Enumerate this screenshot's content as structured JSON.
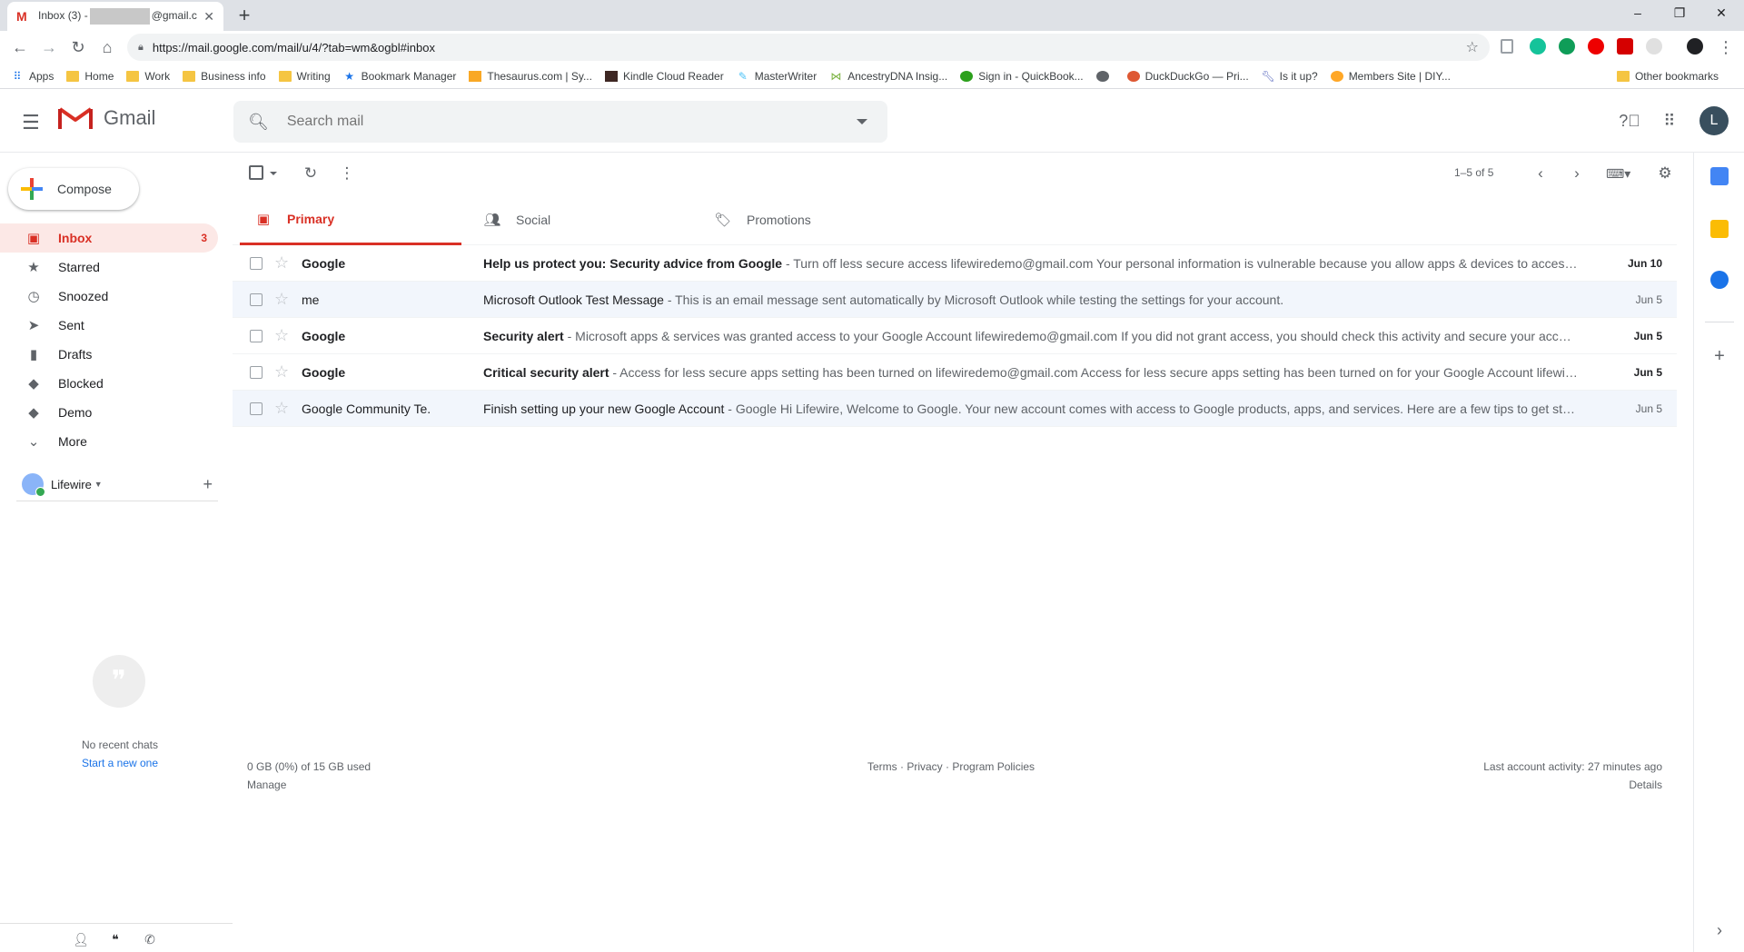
{
  "browser": {
    "tab_title_prefix": "Inbox (3) -",
    "tab_title_suffix": "@gmail.c",
    "url": "https://mail.google.com/mail/u/4/?tab=wm&ogbl#inbox",
    "bookmarks": [
      {
        "label": "Apps",
        "icon": "apps-grid-icon"
      },
      {
        "label": "Home",
        "icon": "folder-icon"
      },
      {
        "label": "Work",
        "icon": "folder-icon"
      },
      {
        "label": "Business info",
        "icon": "folder-icon"
      },
      {
        "label": "Writing",
        "icon": "folder-icon"
      },
      {
        "label": "Bookmark Manager",
        "icon": "star-icon"
      },
      {
        "label": "Thesaurus.com | Sy...",
        "icon": "thesaurus-icon"
      },
      {
        "label": "Kindle Cloud Reader",
        "icon": "kindle-icon"
      },
      {
        "label": "MasterWriter",
        "icon": "masterwriter-icon"
      },
      {
        "label": "AncestryDNA Insig...",
        "icon": "ancestry-icon"
      },
      {
        "label": "Sign in - QuickBook...",
        "icon": "quickbooks-icon"
      },
      {
        "label": "",
        "icon": "globe-icon"
      },
      {
        "label": "DuckDuckGo — Pri...",
        "icon": "duckduckgo-icon"
      },
      {
        "label": "Is it up?",
        "icon": "wrench-icon"
      },
      {
        "label": "Members Site | DIY...",
        "icon": "members-icon"
      }
    ],
    "other_bookmarks": "Other bookmarks"
  },
  "gmail": {
    "brand": "Gmail",
    "search_placeholder": "Search mail",
    "avatar_letter": "L",
    "compose_label": "Compose",
    "nav": [
      {
        "label": "Inbox",
        "count": "3",
        "icon": "inbox-icon",
        "active": true
      },
      {
        "label": "Starred",
        "count": "",
        "icon": "star-icon",
        "active": false
      },
      {
        "label": "Snoozed",
        "count": "",
        "icon": "clock-icon",
        "active": false
      },
      {
        "label": "Sent",
        "count": "",
        "icon": "send-icon",
        "active": false
      },
      {
        "label": "Drafts",
        "count": "",
        "icon": "draft-icon",
        "active": false
      },
      {
        "label": "Blocked",
        "count": "",
        "icon": "label-icon",
        "active": false
      },
      {
        "label": "Demo",
        "count": "",
        "icon": "label-icon",
        "active": false
      },
      {
        "label": "More",
        "count": "",
        "icon": "chevron-down-icon",
        "active": false
      }
    ],
    "account_name": "Lifewire",
    "chat": {
      "no_chats": "No recent chats",
      "start_new": "Start a new one"
    },
    "pager": "1–5 of 5",
    "tabs": [
      {
        "label": "Primary",
        "icon": "inbox-icon",
        "active": true
      },
      {
        "label": "Social",
        "icon": "people-icon",
        "active": false
      },
      {
        "label": "Promotions",
        "icon": "tag-icon",
        "active": false
      }
    ],
    "emails": [
      {
        "sender": "Google",
        "subject": "Help us protect you: Security advice from Google",
        "snippet": " - Turn off less secure access lifewiredemo@gmail.com Your personal information is vulnerable because you allow apps & devices to access your account",
        "date": "Jun 10",
        "unread": true
      },
      {
        "sender": "me",
        "subject": "Microsoft Outlook Test Message",
        "snippet": " - This is an email message sent automatically by Microsoft Outlook while testing the settings for your account.",
        "date": "Jun 5",
        "unread": false
      },
      {
        "sender": "Google",
        "subject": "Security alert",
        "snippet": " - Microsoft apps & services was granted access to your Google Account lifewiredemo@gmail.com If you did not grant access, you should check this activity and secure your account",
        "date": "Jun 5",
        "unread": true
      },
      {
        "sender": "Google",
        "subject": "Critical security alert",
        "snippet": " - Access for less secure apps setting has been turned on lifewiredemo@gmail.com Access for less secure apps setting has been turned on for your Google Account lifewiredemo",
        "date": "Jun 5",
        "unread": true
      },
      {
        "sender": "Google Community Te.",
        "subject": "Finish setting up your new Google Account",
        "snippet": " - Google Hi Lifewire, Welcome to Google. Your new account comes with access to Google products, apps, and services. Here are a few tips to get started",
        "date": "Jun 5",
        "unread": false
      }
    ],
    "footer": {
      "storage": "0 GB (0%) of 15 GB used",
      "manage": "Manage",
      "terms": "Terms",
      "privacy": "Privacy",
      "policies": "Program Policies",
      "activity": "Last account activity: 27 minutes ago",
      "details": "Details"
    }
  },
  "colors": {
    "accent_red": "#d93025",
    "active_bg": "#fce8e6",
    "read_row_bg": "#f2f6fc"
  }
}
